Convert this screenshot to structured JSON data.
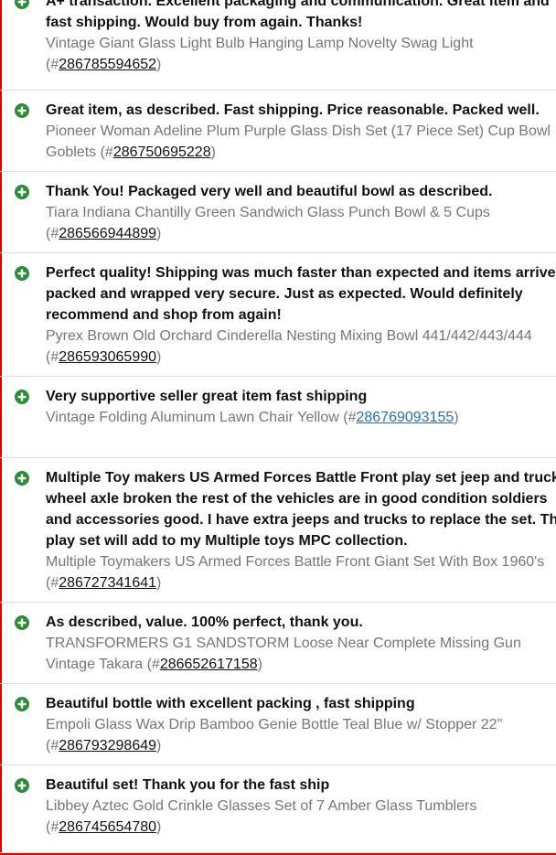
{
  "feedback": [
    {
      "type": "positive",
      "icon": "plus-circle-icon",
      "comment_lines": [
        "A+ transaction. Excellent packaging and communication. Great item and",
        "fast shipping. Would buy from again. Thanks!"
      ],
      "item_lines": [
        "Vintage Giant Glass Light Bulb Hanging Lamp Novelty Swag Light"
      ],
      "item_tail_prefix": "(#",
      "item_number": "286785594652",
      "item_tail_suffix": ")"
    },
    {
      "type": "positive",
      "icon": "plus-circle-icon",
      "comment_lines": [
        "Great item, as described. Fast shipping. Price reasonable. Packed well."
      ],
      "item_lines": [
        "Pioneer Woman Adeline Plum Purple Glass Dish Set (17 Piece Set) Cup Bowl"
      ],
      "item_tail_prefix": "Goblets (#",
      "item_number": "286750695228",
      "item_tail_suffix": ")"
    },
    {
      "type": "positive",
      "icon": "plus-circle-icon",
      "comment_lines": [
        "Thank You! Packaged very well and beautiful bowl as described."
      ],
      "item_lines": [
        "Tiara Indiana Chantilly Green Sandwich Glass Punch Bowl & 5 Cups"
      ],
      "item_tail_prefix": "(#",
      "item_number": "286566944899",
      "item_tail_suffix": ")"
    },
    {
      "type": "positive",
      "icon": "plus-circle-icon",
      "comment_lines": [
        "Perfect quality! Shipping was much faster than expected and items arrived",
        "packed and wrapped very secure. Just as expected. Would definitely",
        "recommend and shop from again!"
      ],
      "item_lines": [
        "Pyrex Brown Old Orchard Cinderella Nesting Mixing Bowl 441/442/443/444"
      ],
      "item_tail_prefix": "(#",
      "item_number": "286593065990",
      "item_tail_suffix": ")"
    },
    {
      "type": "positive",
      "icon": "plus-circle-icon",
      "comment_lines": [
        "Very supportive seller great item fast shipping"
      ],
      "item_lines": [],
      "item_tail_prefix": "Vintage Folding Aluminum Lawn Chair Yellow (#",
      "item_number": "286769093155",
      "item_tail_suffix": ")",
      "visited": true
    },
    {
      "type": "positive",
      "icon": "plus-circle-icon",
      "comment_lines": [
        "Multiple Toy makers US Armed Forces Battle Front play set jeep and truck",
        "wheel axle broken the rest of the vehicles are in good condition soldiers",
        "and accessories good. I have extra jeeps and trucks to replace the set. The",
        "play set will add to my Multiple toys MPC collection."
      ],
      "item_lines": [
        "Multiple Toymakers US Armed Forces Battle Front Giant Set With Box 1960's"
      ],
      "item_tail_prefix": "(#",
      "item_number": "286727341641",
      "item_tail_suffix": ")"
    },
    {
      "type": "positive",
      "icon": "plus-circle-icon",
      "comment_lines": [
        "As described, value. 100% perfect, thank you."
      ],
      "item_lines": [
        "TRANSFORMERS G1 SANDSTORM Loose Near Complete Missing Gun"
      ],
      "item_tail_prefix": "Vintage Takara (#",
      "item_number": "286652617158",
      "item_tail_suffix": ")"
    },
    {
      "type": "positive",
      "icon": "plus-circle-icon",
      "comment_lines": [
        "Beautiful bottle with excellent packing , fast shipping"
      ],
      "item_lines": [
        "Empoli Glass Wax Drip Bamboo Genie Bottle Teal Blue w/ Stopper 22\""
      ],
      "item_tail_prefix": "(#",
      "item_number": "286793298649",
      "item_tail_suffix": ")"
    },
    {
      "type": "positive",
      "icon": "plus-circle-icon",
      "comment_lines": [
        "Beautiful set! Thank you for the fast ship"
      ],
      "item_lines": [
        "Libbey Aztec Gold Crinkle Glasses Set of 7 Amber Glass Tumblers"
      ],
      "item_tail_prefix": "(#",
      "item_number": "286745654780",
      "item_tail_suffix": ")"
    }
  ],
  "colors": {
    "positive_icon": "#2e8b3a",
    "frame_border": "#e00000",
    "item_text": "#767676",
    "comment_text": "#111111",
    "visited_link": "#2a6fb0"
  }
}
